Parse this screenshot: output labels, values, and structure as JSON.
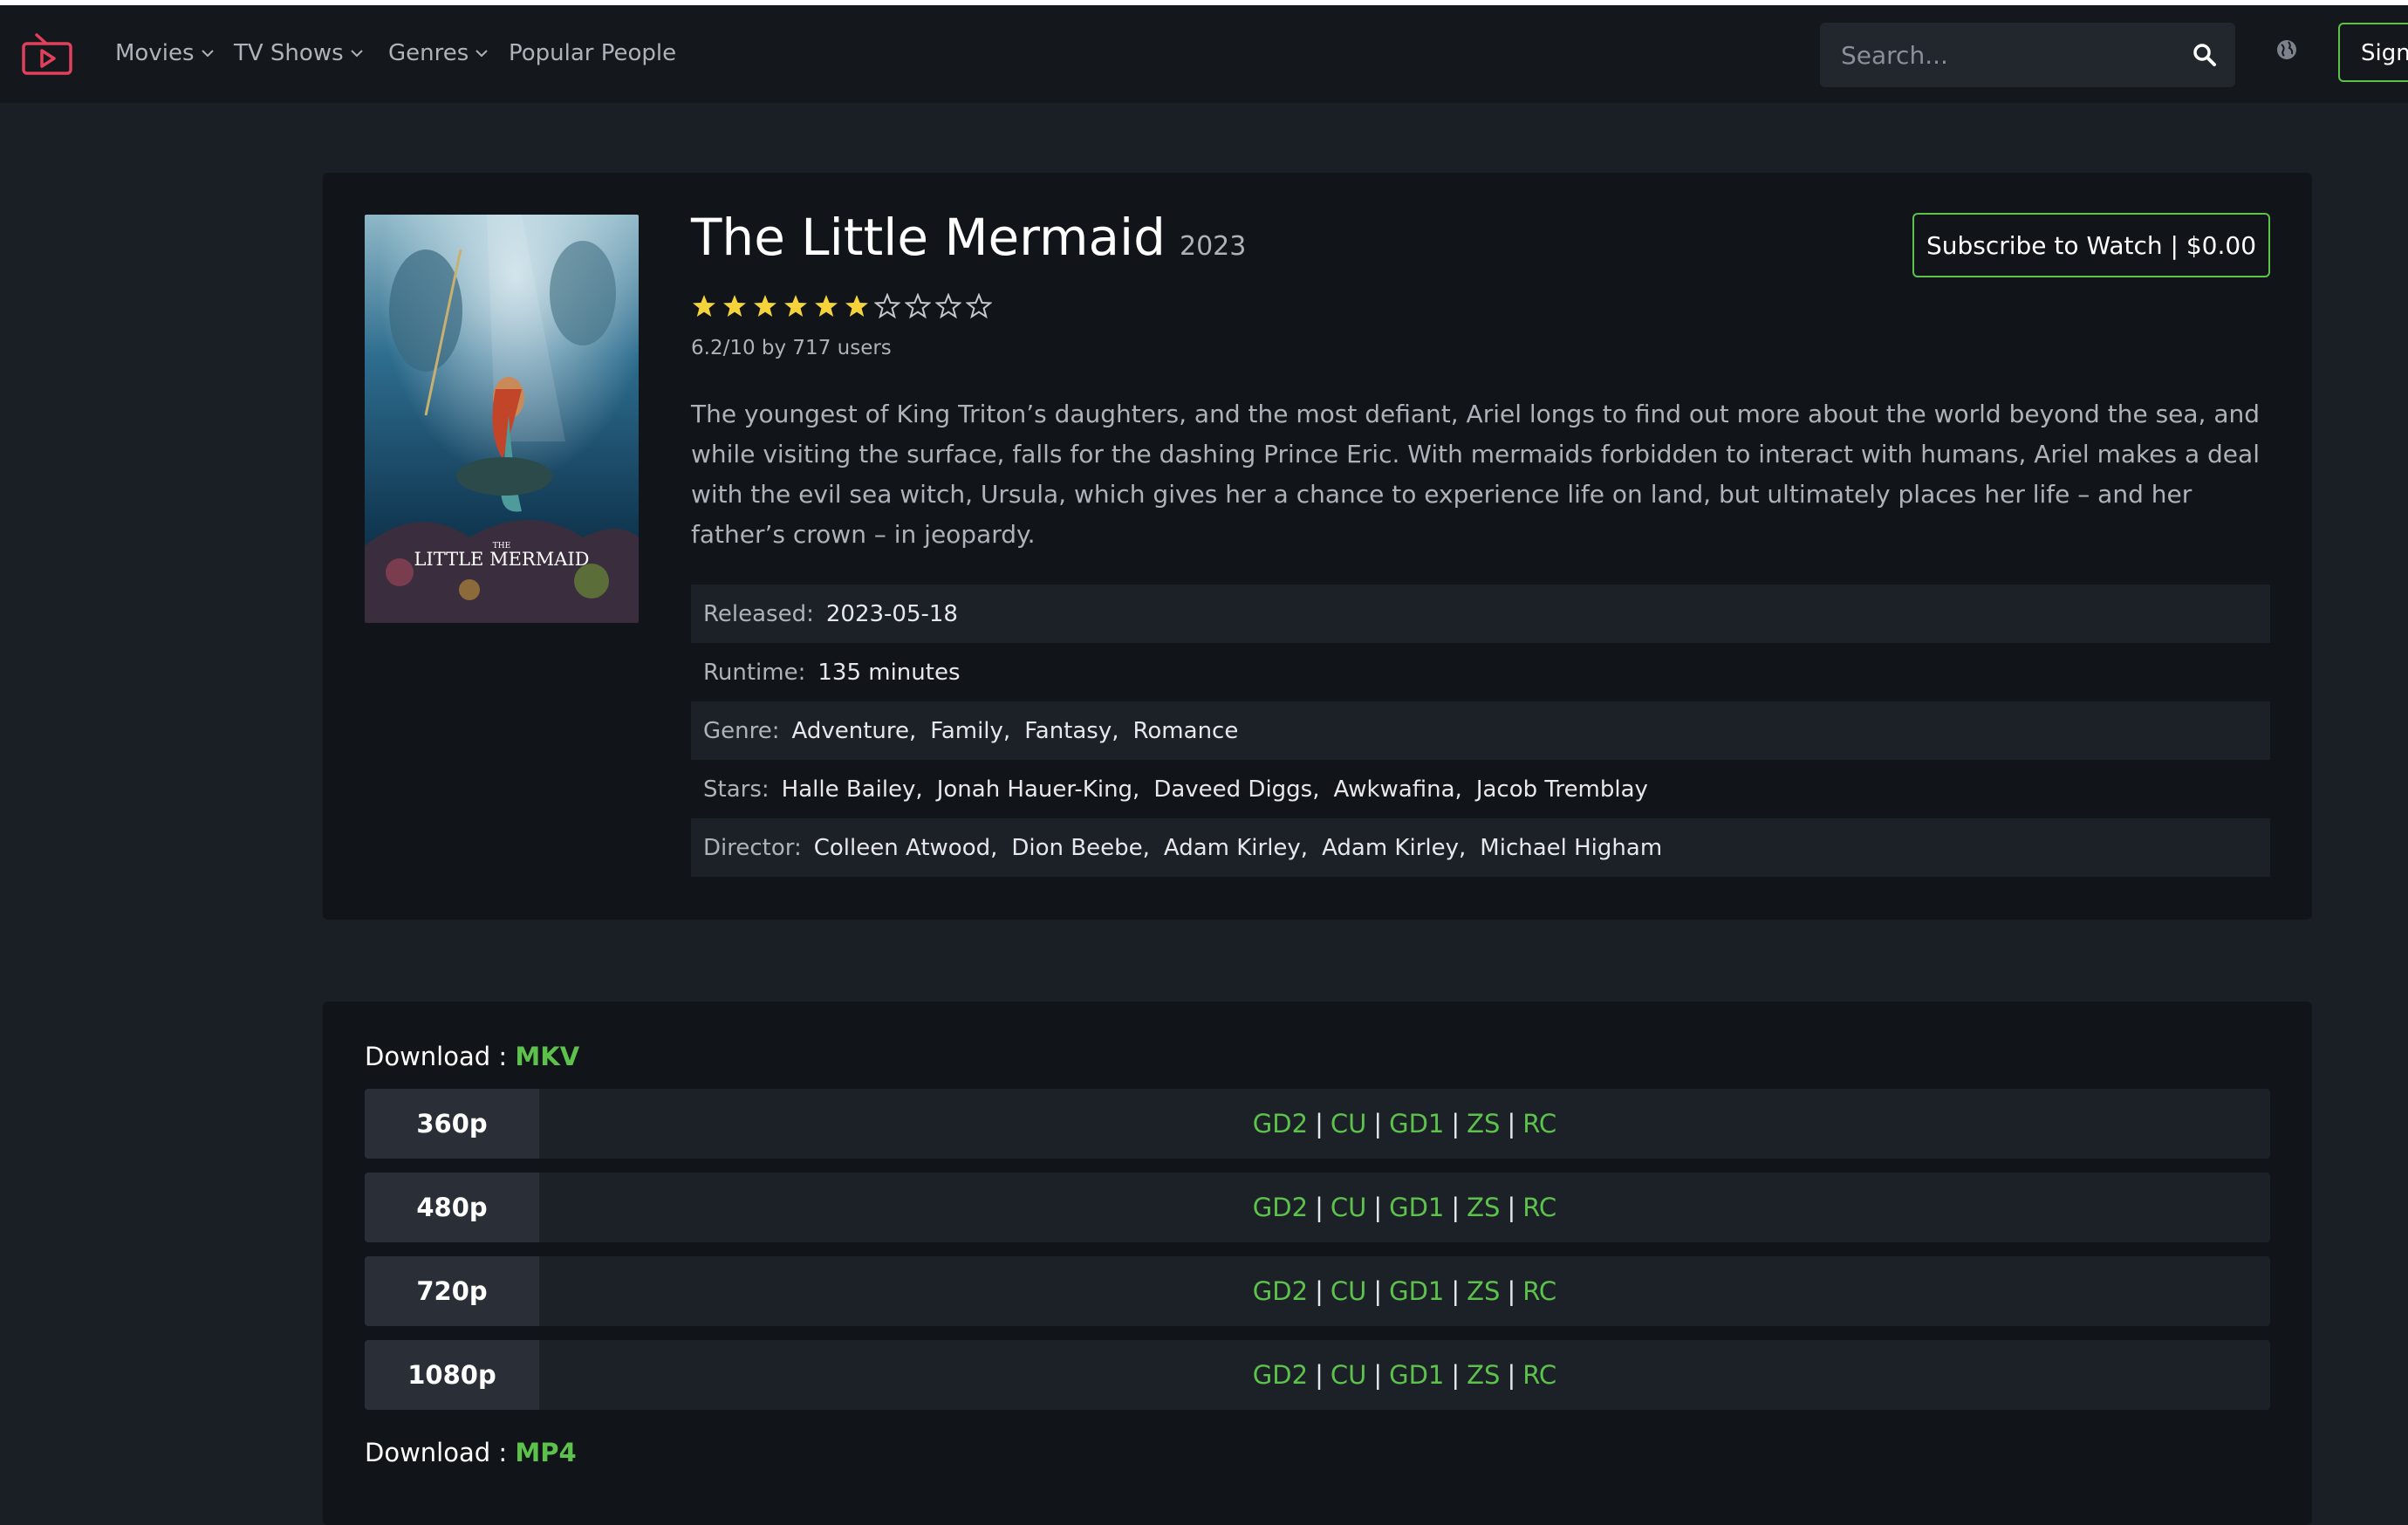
{
  "colors": {
    "accent": "#5dc24c",
    "brand_logo": "#e0405c",
    "star": "#f5d33b",
    "background": "#1a1f26",
    "card": "#111418"
  },
  "nav": {
    "logo_icon": "tv-play-icon",
    "items": [
      {
        "label": "Movies",
        "dropdown": true
      },
      {
        "label": "TV Shows",
        "dropdown": true
      },
      {
        "label": "Genres",
        "dropdown": true
      },
      {
        "label": "Popular People",
        "dropdown": false
      }
    ],
    "search_placeholder": "Search...",
    "search_icon": "search-icon",
    "globe_icon": "globe-icon",
    "signin_label": "Sign"
  },
  "movie": {
    "title": "The Little Mermaid",
    "year": "2023",
    "poster_text_small": "THE",
    "poster_text": "LITTLE MERMAID",
    "rating_value": 6.2,
    "rating_max": 10,
    "rating_text": "6.2/10 by 717 users",
    "subscribe_label": "Subscribe to Watch | $0.00",
    "overview": "The youngest of King Triton’s daughters, and the most defiant, Ariel longs to find out more about the world beyond the sea, and while visiting the surface, falls for the dashing Prince Eric. With mermaids forbidden to interact with humans, Ariel makes a deal with the evil sea witch, Ursula, which gives her a chance to experience life on land, but ultimately places her life – and her father’s crown – in jeopardy.",
    "details": [
      {
        "label": "Released:",
        "values": [
          "2023-05-18"
        ]
      },
      {
        "label": "Runtime:",
        "values": [
          "135 minutes"
        ]
      },
      {
        "label": "Genre:",
        "values": [
          "Adventure,",
          "Family,",
          "Fantasy,",
          "Romance"
        ]
      },
      {
        "label": "Stars:",
        "values": [
          "Halle Bailey,",
          "Jonah Hauer-King,",
          "Daveed Diggs,",
          "Awkwafina,",
          "Jacob Tremblay"
        ]
      },
      {
        "label": "Director:",
        "values": [
          "Colleen Atwood,",
          "Dion Beebe,",
          "Adam Kirley,",
          "Adam Kirley,",
          "Michael Higham"
        ]
      }
    ]
  },
  "downloads": [
    {
      "prefix": "Download : ",
      "format": "MKV",
      "rows": [
        {
          "resolution": "360p",
          "links": [
            "GD2",
            "CU",
            "GD1",
            "ZS",
            "RC"
          ]
        },
        {
          "resolution": "480p",
          "links": [
            "GD2",
            "CU",
            "GD1",
            "ZS",
            "RC"
          ]
        },
        {
          "resolution": "720p",
          "links": [
            "GD2",
            "CU",
            "GD1",
            "ZS",
            "RC"
          ]
        },
        {
          "resolution": "1080p",
          "links": [
            "GD2",
            "CU",
            "GD1",
            "ZS",
            "RC"
          ]
        }
      ]
    },
    {
      "prefix": "Download : ",
      "format": "MP4",
      "rows": []
    }
  ],
  "link_separator": "|"
}
